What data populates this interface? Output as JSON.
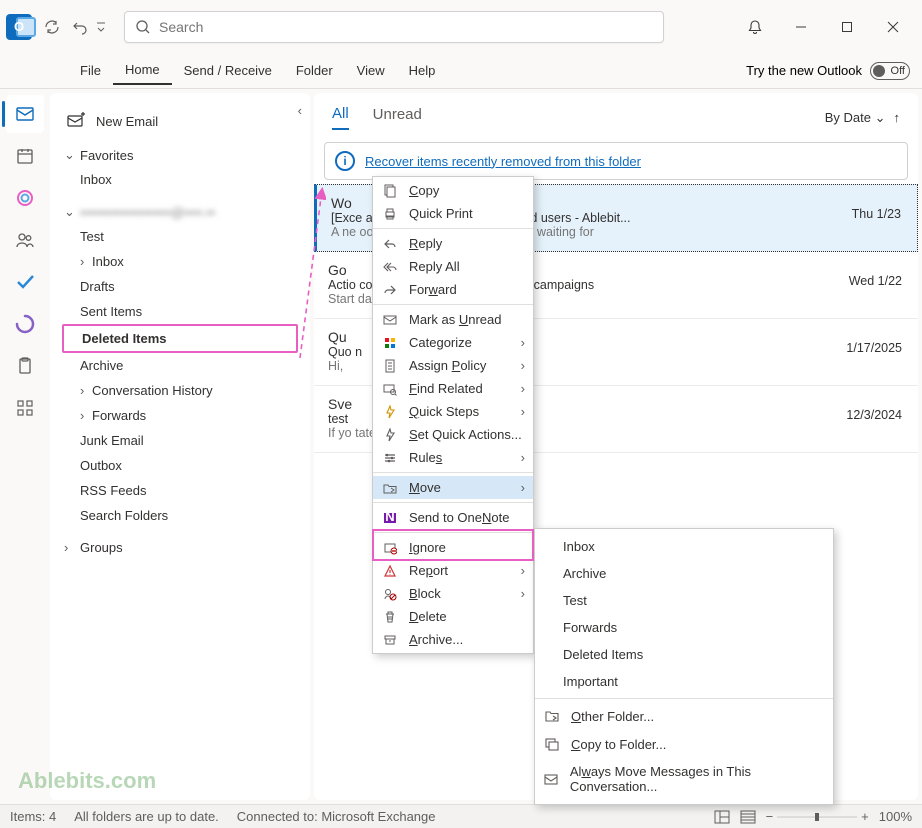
{
  "search": {
    "placeholder": "Search"
  },
  "ribbon": {
    "tabs": [
      "File",
      "Home",
      "Send / Receive",
      "Folder",
      "View",
      "Help"
    ],
    "try_new": "Try the new Outlook",
    "toggle": "Off"
  },
  "folders": {
    "new_email": "New Email",
    "favorites": "Favorites",
    "fav_items": [
      "Inbox"
    ],
    "account_blurred": "••••••••••••••••••••@••••.••",
    "items": [
      "Test",
      "Inbox",
      "Drafts",
      "Sent Items",
      "Deleted Items",
      "Archive",
      "Conversation History",
      "Forwards",
      "Junk Email",
      "Outbox",
      "RSS Feeds",
      "Search Folders"
    ],
    "groups": "Groups"
  },
  "msglist": {
    "filter_all": "All",
    "filter_unread": "Unread",
    "sort": "By Date",
    "recover_link": "Recover items recently removed from this folder",
    "messages": [
      {
        "sender": "Wo",
        "subject": "[Exce                                             as for beginners and advanced users - Ablebit...",
        "preview": "A ne                                             oogle Calendar with Outlook\" is waiting for",
        "date": "Thu 1/23"
      },
      {
        "sender": "Go",
        "subject": "Actio                                             conversions to strengthen your campaigns",
        "preview": "Start                                             day.    ...",
        "date": "Wed 1/22"
      },
      {
        "sender": "Qu",
        "subject": "Quo                                             n",
        "preview": "Hi,",
        "date": "1/17/2025"
      },
      {
        "sender": "Sve",
        "subject": "test",
        "preview": "If yo                                             tate to ask me.",
        "date": "12/3/2024"
      }
    ]
  },
  "context_menu": {
    "items": [
      {
        "label": "Copy",
        "u": "C"
      },
      {
        "label": "Quick Print",
        "u": null
      },
      {
        "sep": true
      },
      {
        "label": "Reply",
        "u": "R"
      },
      {
        "label": "Reply All",
        "u": null
      },
      {
        "label": "Forward",
        "u": "w"
      },
      {
        "sep": true
      },
      {
        "label": "Mark as Unread",
        "u": "U"
      },
      {
        "label": "Categorize",
        "u": null,
        "arrow": true
      },
      {
        "label": "Assign Policy",
        "u": "P",
        "arrow": true
      },
      {
        "label": "Find Related",
        "u": "F",
        "arrow": true
      },
      {
        "label": "Quick Steps",
        "u": "Q",
        "arrow": true
      },
      {
        "label": "Set Quick Actions...",
        "u": "S"
      },
      {
        "label": "Rules",
        "u": "s",
        "arrow": true
      },
      {
        "sep": true
      },
      {
        "label": "Move",
        "u": "M",
        "arrow": true,
        "hi": true
      },
      {
        "sep": true
      },
      {
        "label": "Send to OneNote",
        "u": "N"
      },
      {
        "sep": true
      },
      {
        "label": "Ignore",
        "u": "I"
      },
      {
        "label": "Report",
        "u": "p",
        "arrow": true
      },
      {
        "label": "Block",
        "u": "B",
        "arrow": true
      },
      {
        "label": "Delete",
        "u": "D"
      },
      {
        "label": "Archive...",
        "u": "A"
      }
    ]
  },
  "submenu": {
    "folders": [
      "Inbox",
      "Archive",
      "Test",
      "Forwards",
      "Deleted Items",
      "Important"
    ],
    "other_folder": "Other Folder...",
    "copy_folder": "Copy to Folder...",
    "always_move": "Always Move Messages in This Conversation..."
  },
  "statusbar": {
    "items_count": "Items: 4",
    "uptodate": "All folders are up to date.",
    "connected": "Connected to: Microsoft Exchange",
    "zoom": "100%"
  },
  "watermark": "Ablebits.com"
}
